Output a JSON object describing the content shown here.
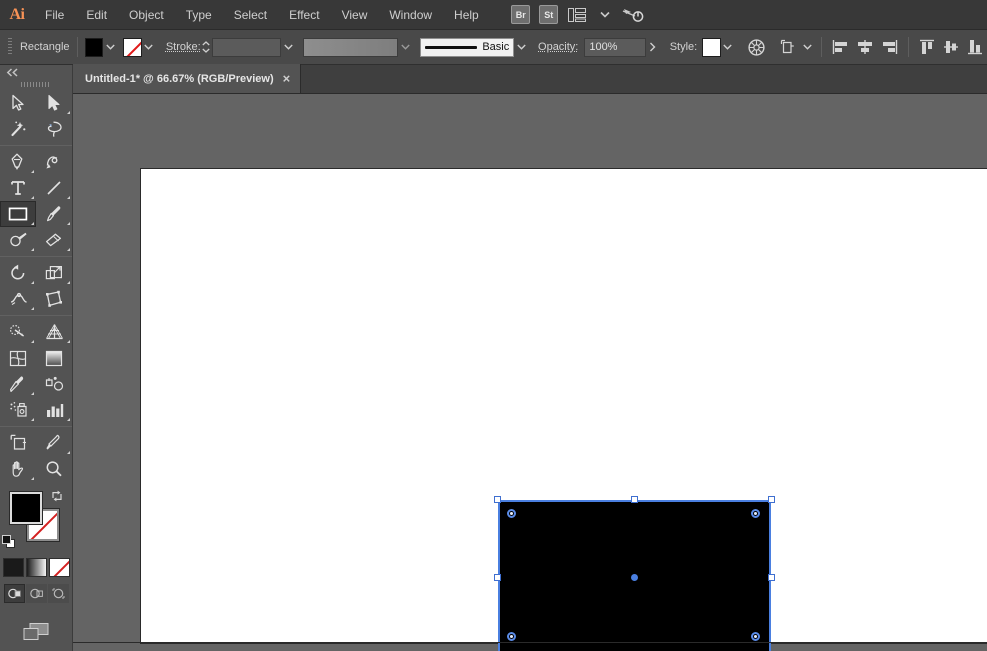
{
  "app": {
    "name": "Adobe Illustrator",
    "logo_text": "Ai",
    "accent_color": "#f79256",
    "selection_color": "#4a7fe0"
  },
  "menubar": {
    "items": [
      {
        "label": "File"
      },
      {
        "label": "Edit"
      },
      {
        "label": "Object"
      },
      {
        "label": "Type"
      },
      {
        "label": "Select"
      },
      {
        "label": "Effect"
      },
      {
        "label": "View"
      },
      {
        "label": "Window"
      },
      {
        "label": "Help"
      }
    ],
    "right_icons": [
      {
        "name": "bridge-button",
        "label": "Br"
      },
      {
        "name": "stock-button",
        "label": "St"
      },
      {
        "name": "workspace-switcher-icon",
        "label": ""
      },
      {
        "name": "workspace-chevron-icon",
        "label": ""
      },
      {
        "name": "search-adobe-stock-icon",
        "label": ""
      }
    ]
  },
  "controlbar": {
    "object_type": "Rectangle",
    "fill_label": "Fill",
    "fill_color": "#000000",
    "stroke_color_label": "None",
    "stroke_label": "Stroke:",
    "stroke_weight": "",
    "stroke_weight_placeholder": "",
    "variable_width_profile": "",
    "brush_definition": "Basic",
    "opacity_label": "Opacity:",
    "opacity_value": "100%",
    "style_label": "Style:",
    "recolor_artwork_name": "recolor-artwork-icon",
    "transform_name": "transform-icon",
    "align_icons": [
      "align-left-icon",
      "align-horizontal-center-icon",
      "align-right-icon",
      "align-top-icon",
      "align-vertical-center-icon",
      "align-bottom-icon"
    ]
  },
  "tabbar": {
    "tab_title": "Untitled-1* @ 66.67% (RGB/Preview)",
    "close_label": "×"
  },
  "toolbar": {
    "collapse_label": "«",
    "tools": [
      {
        "name": "selection-tool",
        "label": "Selection",
        "active": false,
        "has_flyout": false
      },
      {
        "name": "direct-selection-tool",
        "label": "Direct Selection",
        "active": false,
        "has_flyout": true
      },
      {
        "name": "magic-wand-tool",
        "label": "Magic Wand",
        "active": false,
        "has_flyout": false
      },
      {
        "name": "lasso-tool",
        "label": "Lasso",
        "active": false,
        "has_flyout": false
      },
      {
        "name": "pen-tool",
        "label": "Pen",
        "active": false,
        "has_flyout": true
      },
      {
        "name": "curvature-tool",
        "label": "Curvature",
        "active": false,
        "has_flyout": false
      },
      {
        "name": "type-tool",
        "label": "Type",
        "active": false,
        "has_flyout": true
      },
      {
        "name": "line-segment-tool",
        "label": "Line Segment",
        "active": false,
        "has_flyout": true
      },
      {
        "name": "rectangle-tool",
        "label": "Rectangle",
        "active": true,
        "has_flyout": true
      },
      {
        "name": "paintbrush-tool",
        "label": "Paintbrush",
        "active": false,
        "has_flyout": true
      },
      {
        "name": "shaper-tool",
        "label": "Shaper",
        "active": false,
        "has_flyout": true
      },
      {
        "name": "eraser-tool",
        "label": "Eraser",
        "active": false,
        "has_flyout": true
      },
      {
        "name": "rotate-tool",
        "label": "Rotate",
        "active": false,
        "has_flyout": true
      },
      {
        "name": "scale-tool",
        "label": "Scale",
        "active": false,
        "has_flyout": true
      },
      {
        "name": "width-tool",
        "label": "Width",
        "active": false,
        "has_flyout": true
      },
      {
        "name": "free-transform-tool",
        "label": "Free Transform",
        "active": false,
        "has_flyout": false
      },
      {
        "name": "shape-builder-tool",
        "label": "Shape Builder",
        "active": false,
        "has_flyout": true
      },
      {
        "name": "perspective-grid-tool",
        "label": "Perspective Grid",
        "active": false,
        "has_flyout": true
      },
      {
        "name": "mesh-tool",
        "label": "Mesh",
        "active": false,
        "has_flyout": false
      },
      {
        "name": "gradient-tool",
        "label": "Gradient",
        "active": false,
        "has_flyout": false
      },
      {
        "name": "eyedropper-tool",
        "label": "Eyedropper",
        "active": false,
        "has_flyout": true
      },
      {
        "name": "blend-tool",
        "label": "Blend",
        "active": false,
        "has_flyout": false
      },
      {
        "name": "symbol-sprayer-tool",
        "label": "Symbol Sprayer",
        "active": false,
        "has_flyout": true
      },
      {
        "name": "column-graph-tool",
        "label": "Column Graph",
        "active": false,
        "has_flyout": true
      },
      {
        "name": "artboard-tool",
        "label": "Artboard",
        "active": false,
        "has_flyout": false
      },
      {
        "name": "slice-tool",
        "label": "Slice",
        "active": false,
        "has_flyout": true
      },
      {
        "name": "hand-tool",
        "label": "Hand",
        "active": false,
        "has_flyout": true
      },
      {
        "name": "zoom-tool",
        "label": "Zoom",
        "active": false,
        "has_flyout": false
      }
    ],
    "fill_color": "#000000",
    "stroke_color": "None",
    "swap_fill_stroke_name": "swap-fill-stroke-icon",
    "default_fill_stroke_name": "default-fill-stroke-icon",
    "paint_modes": [
      {
        "name": "color-mode-button",
        "label": "Color"
      },
      {
        "name": "gradient-mode-button",
        "label": "Gradient"
      },
      {
        "name": "none-mode-button",
        "label": "None"
      }
    ],
    "draw_modes": [
      {
        "name": "draw-normal-button",
        "label": "Draw Normal",
        "active": true
      },
      {
        "name": "draw-behind-button",
        "label": "Draw Behind",
        "active": false
      },
      {
        "name": "draw-inside-button",
        "label": "Draw Inside",
        "active": false
      }
    ],
    "screen_mode_name": "change-screen-mode-icon"
  },
  "canvas": {
    "background_color": "#646464",
    "artboard_color": "#ffffff",
    "zoom_level": "66.67%",
    "color_mode": "RGB",
    "view_mode": "Preview",
    "selected_object": {
      "type": "Rectangle",
      "fill": "#000000",
      "stroke": "None",
      "selected": true,
      "handle_count": 8,
      "corner_widget_count": 4
    }
  }
}
